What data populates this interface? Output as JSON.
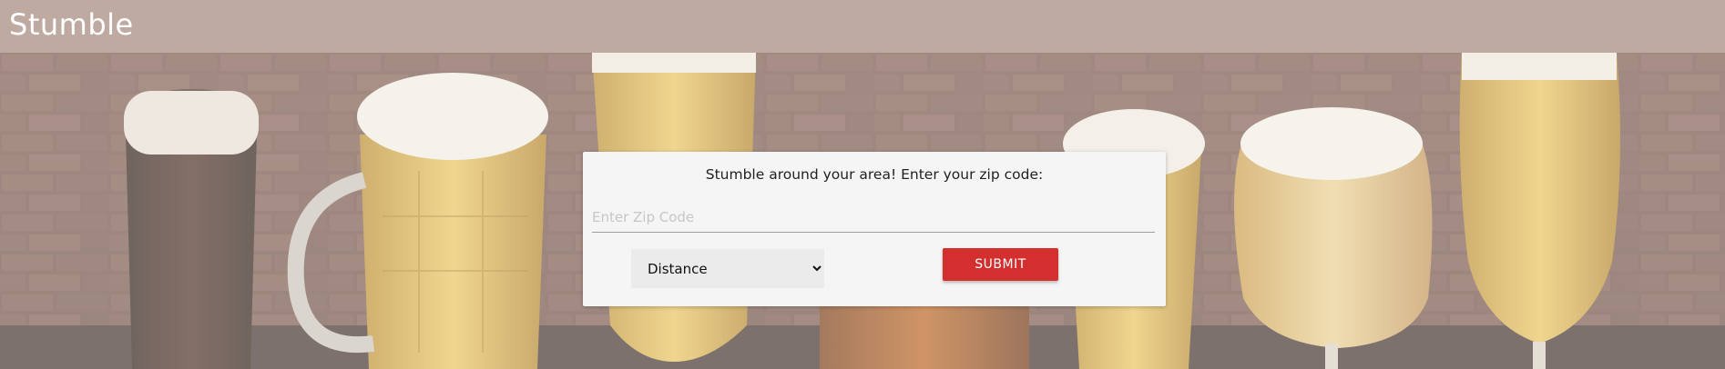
{
  "header": {
    "brand": "Stumble",
    "background_color": "#bfaaa2"
  },
  "background": {
    "image": "beer-glasses-on-brick-wall-photo"
  },
  "form": {
    "prompt": "Stumble around your area! Enter your zip code:",
    "zip_placeholder": "Enter Zip Code",
    "zip_value": "",
    "distance_selected": "Distance",
    "distance_options": [
      "Distance"
    ],
    "submit_label": "SUBMIT",
    "submit_color": "#d32f2f"
  }
}
